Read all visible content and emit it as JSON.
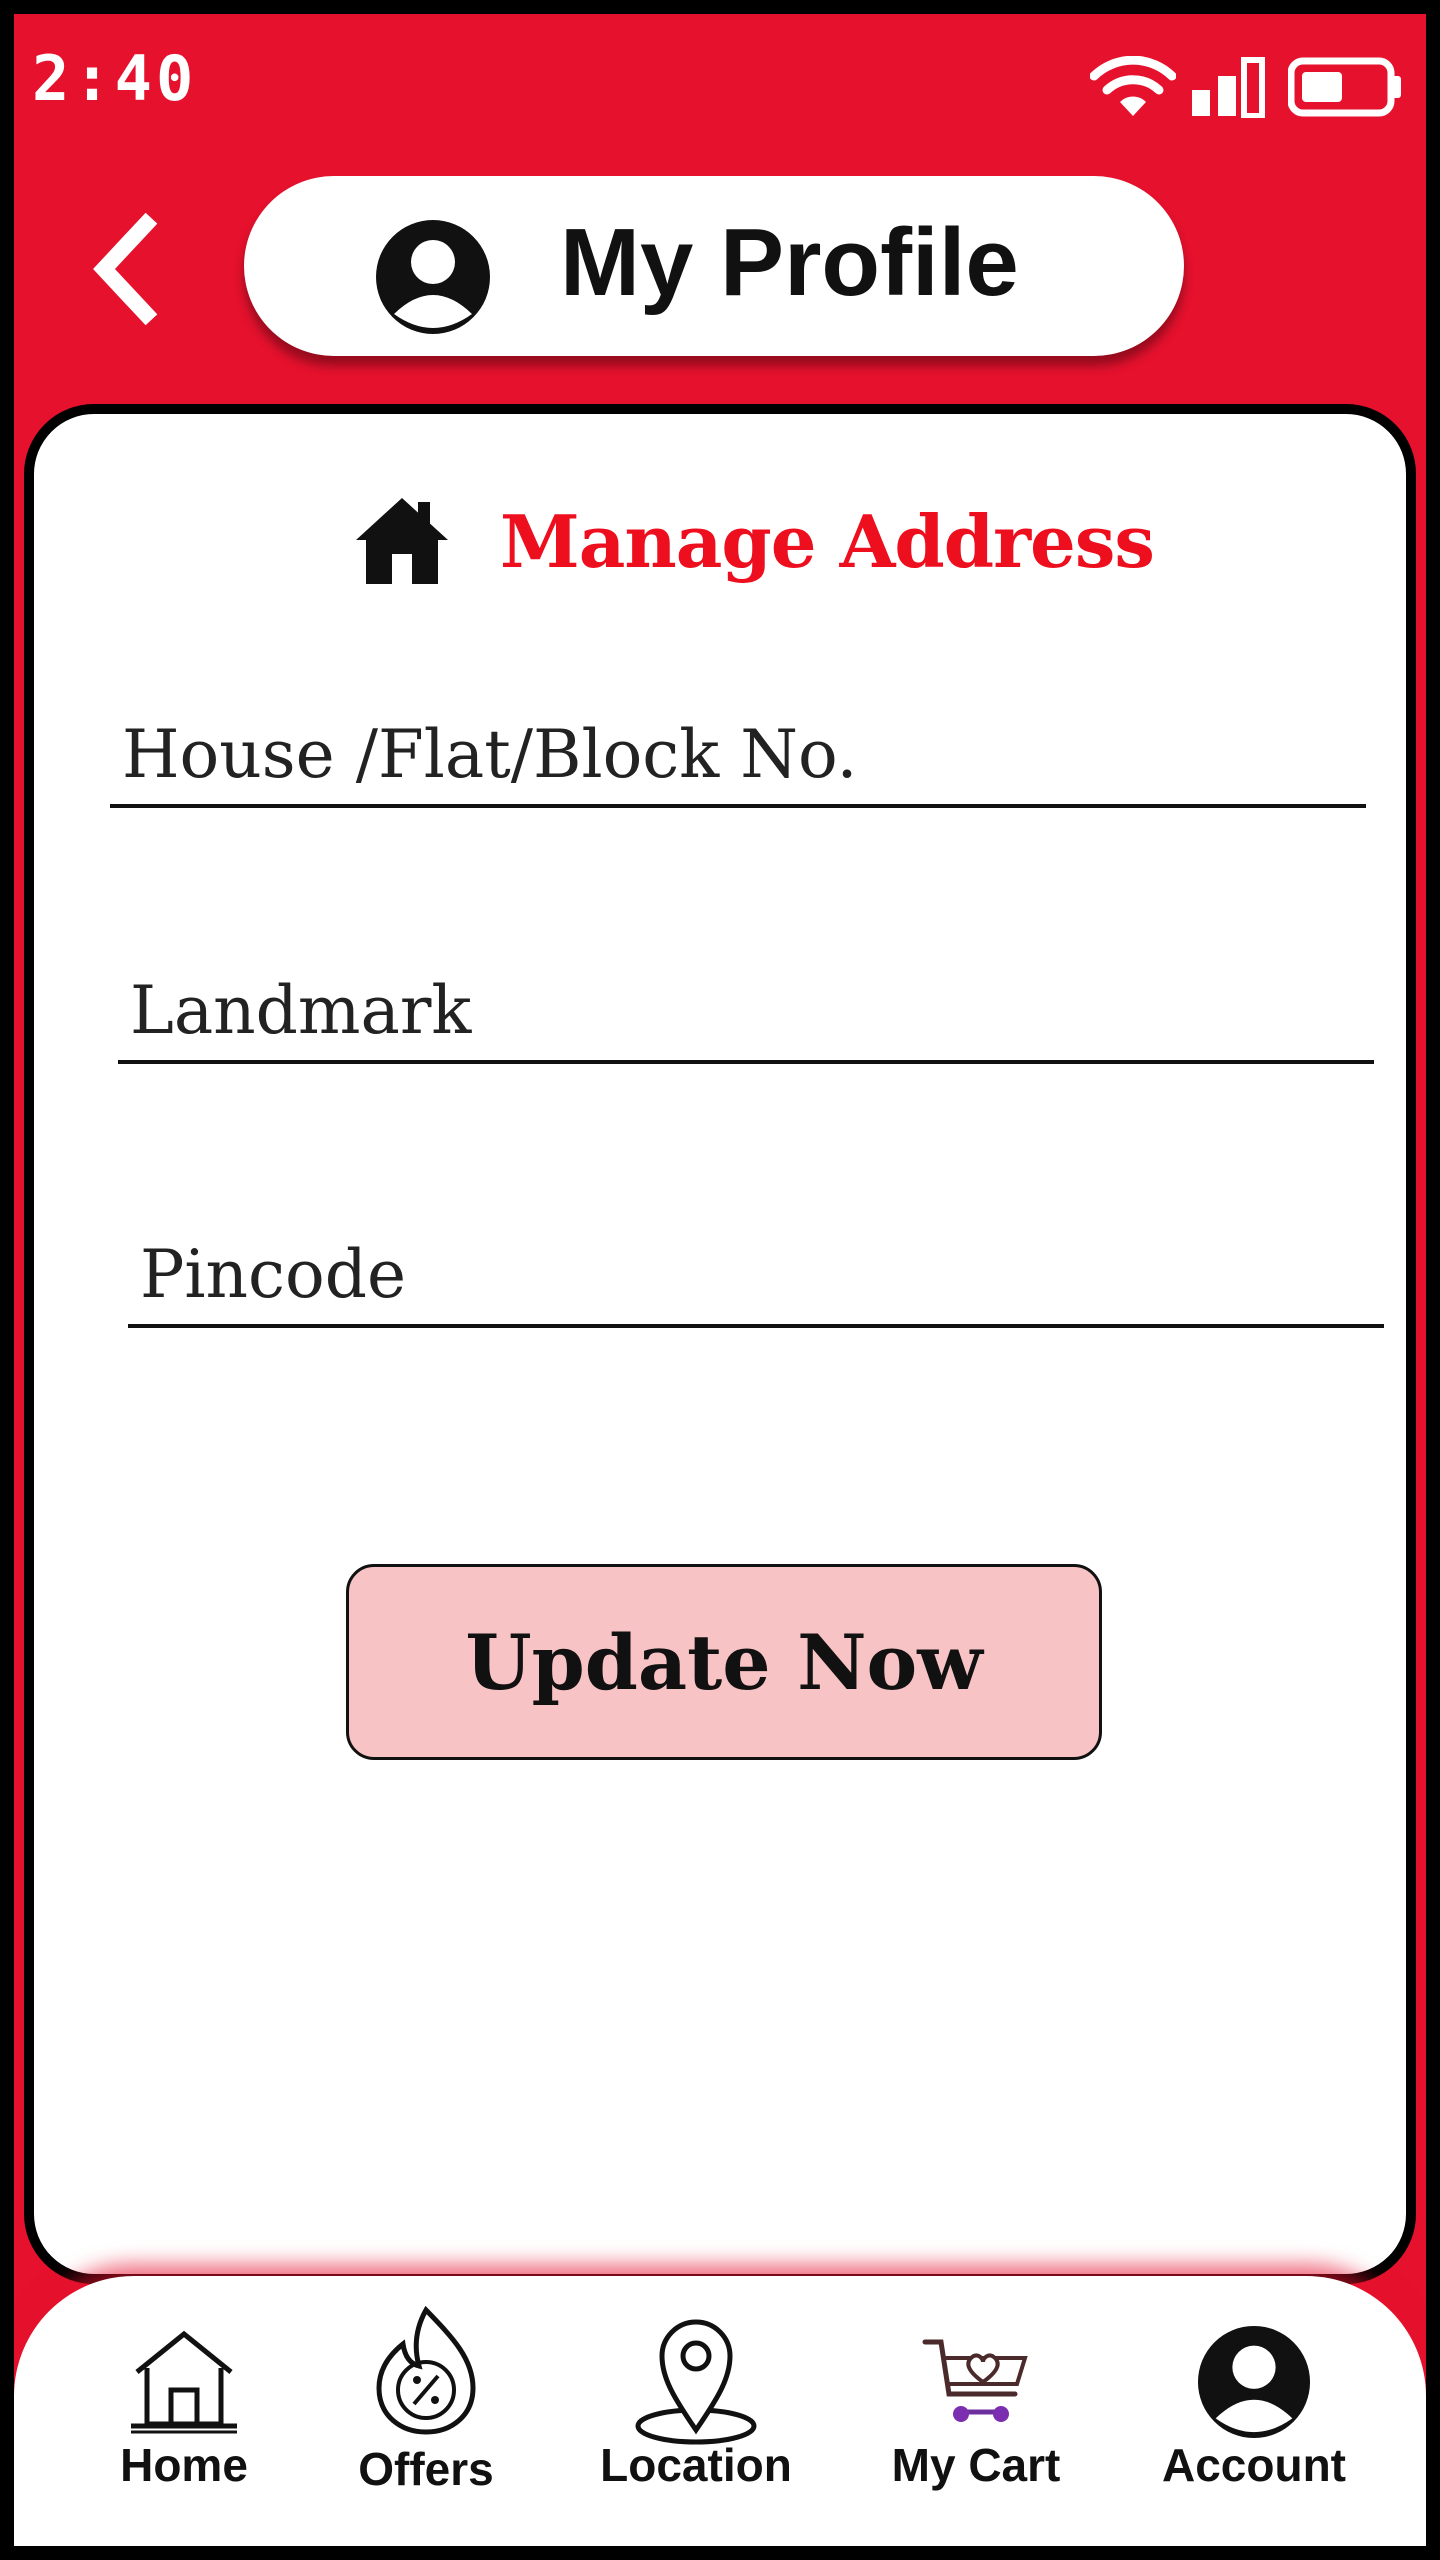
{
  "status_bar": {
    "time": "2:40"
  },
  "header": {
    "title": "My Profile"
  },
  "card": {
    "title": "Manage Address"
  },
  "form": {
    "house_placeholder": "House /Flat/Block No.",
    "landmark_placeholder": "Landmark",
    "pincode_placeholder": "Pincode",
    "submit_label": "Update Now"
  },
  "bottom_nav": {
    "items": [
      {
        "label": "Home",
        "icon": "home-icon"
      },
      {
        "label": "Offers",
        "icon": "offers-icon"
      },
      {
        "label": "Location",
        "icon": "location-pin-icon"
      },
      {
        "label": "My Cart",
        "icon": "cart-icon"
      },
      {
        "label": "Account",
        "icon": "account-icon"
      }
    ]
  },
  "colors": {
    "primary_red": "#e5112d",
    "title_red": "#ee0f1e",
    "button_pink": "#f8c3c4"
  }
}
